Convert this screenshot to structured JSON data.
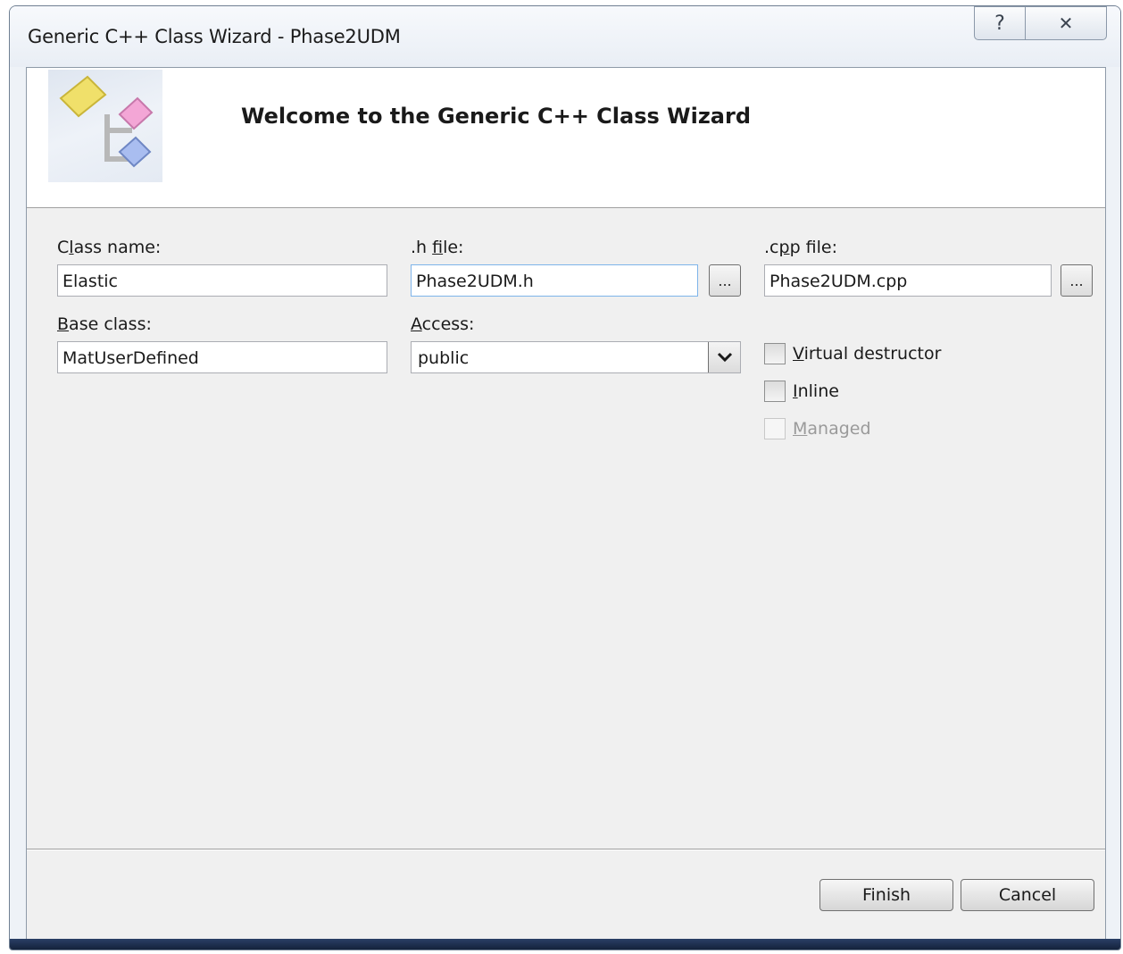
{
  "window": {
    "title": "Generic C++ Class Wizard - Phase2UDM",
    "help_glyph": "?",
    "close_glyph": "✕"
  },
  "header": {
    "title": "Welcome to the Generic C++ Class Wizard"
  },
  "form": {
    "class_name": {
      "label_pre": "C",
      "label_acc": "l",
      "label_post": "ass name:",
      "value": "Elastic"
    },
    "h_file": {
      "label_pre": ".h ",
      "label_acc": "f",
      "label_post": "ile:",
      "value": "Phase2UDM.h"
    },
    "cpp_file": {
      "label_pre": ".c",
      "label_acc": "p",
      "label_post": "p file:",
      "value": "Phase2UDM.cpp"
    },
    "base_class": {
      "label_pre": "",
      "label_acc": "B",
      "label_post": "ase class:",
      "value": "MatUserDefined"
    },
    "access": {
      "label_pre": "",
      "label_acc": "A",
      "label_post": "ccess:",
      "value": "public"
    },
    "browse_label": "...",
    "virtual_destructor": {
      "label_acc": "V",
      "label_post": "irtual destructor",
      "checked": false,
      "enabled": true
    },
    "inline": {
      "label_acc": "I",
      "label_post": "nline",
      "checked": false,
      "enabled": true
    },
    "managed": {
      "label_acc": "M",
      "label_post": "anaged",
      "checked": false,
      "enabled": false
    }
  },
  "buttons": {
    "finish": "Finish",
    "cancel": "Cancel"
  },
  "colors": {
    "accent_yellow": "#f0e06a",
    "accent_pink": "#f3a6d6",
    "accent_blue": "#a9bdf0"
  }
}
